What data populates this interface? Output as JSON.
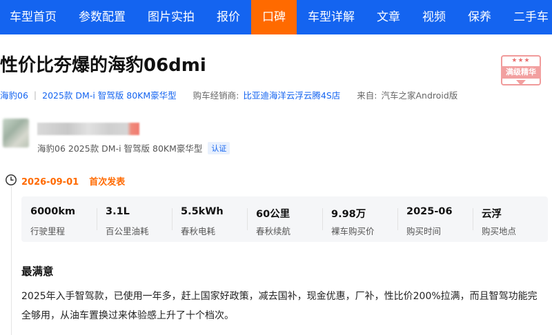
{
  "nav": {
    "items": [
      {
        "label": "车型首页"
      },
      {
        "label": "参数配置"
      },
      {
        "label": "图片实拍"
      },
      {
        "label": "报价"
      },
      {
        "label": "口碑",
        "active": true
      },
      {
        "label": "车型详解"
      },
      {
        "label": "文章"
      },
      {
        "label": "视频"
      },
      {
        "label": "保养"
      },
      {
        "label": "二手车"
      }
    ],
    "color": "#1464f0",
    "active_color": "#ff6a00"
  },
  "article": {
    "title": "性价比夯爆的海豹06dmi",
    "badge": {
      "stars": "★★★",
      "label": "满级精华"
    },
    "meta": {
      "series": "海豹06",
      "model": "2025款 DM-i 智驾版 80KM豪华型",
      "dealer_label": "购车经销商:",
      "dealer": "比亚迪海洋云浮云腾4S店",
      "source_label": "来自:",
      "source": "汽车之家Android版"
    }
  },
  "user": {
    "car": "海豹06 2025款 DM-i 智驾版 80KM豪华型",
    "verified": "认证"
  },
  "post": {
    "date": "2026-09-01",
    "tag": "首次发表"
  },
  "stats": [
    {
      "value": "6000km",
      "label": "行驶里程"
    },
    {
      "value": "3.1L",
      "label": "百公里油耗"
    },
    {
      "value": "5.5kWh",
      "label": "春秋电耗"
    },
    {
      "value": "60公里",
      "label": "春秋续航"
    },
    {
      "value": "9.98万",
      "label": "裸车购买价"
    },
    {
      "value": "2025-06",
      "label": "购买时间"
    },
    {
      "value": "云浮",
      "label": "购买地点"
    }
  ],
  "section": {
    "title": "最满意",
    "body": "2025年入手智驾款，已使用一年多，赶上国家好政策，减去国补，现金优惠，厂补，性比价200%拉满，而且智驾功能完全够用，从油车置换过来体验感上升了十个档次。"
  }
}
